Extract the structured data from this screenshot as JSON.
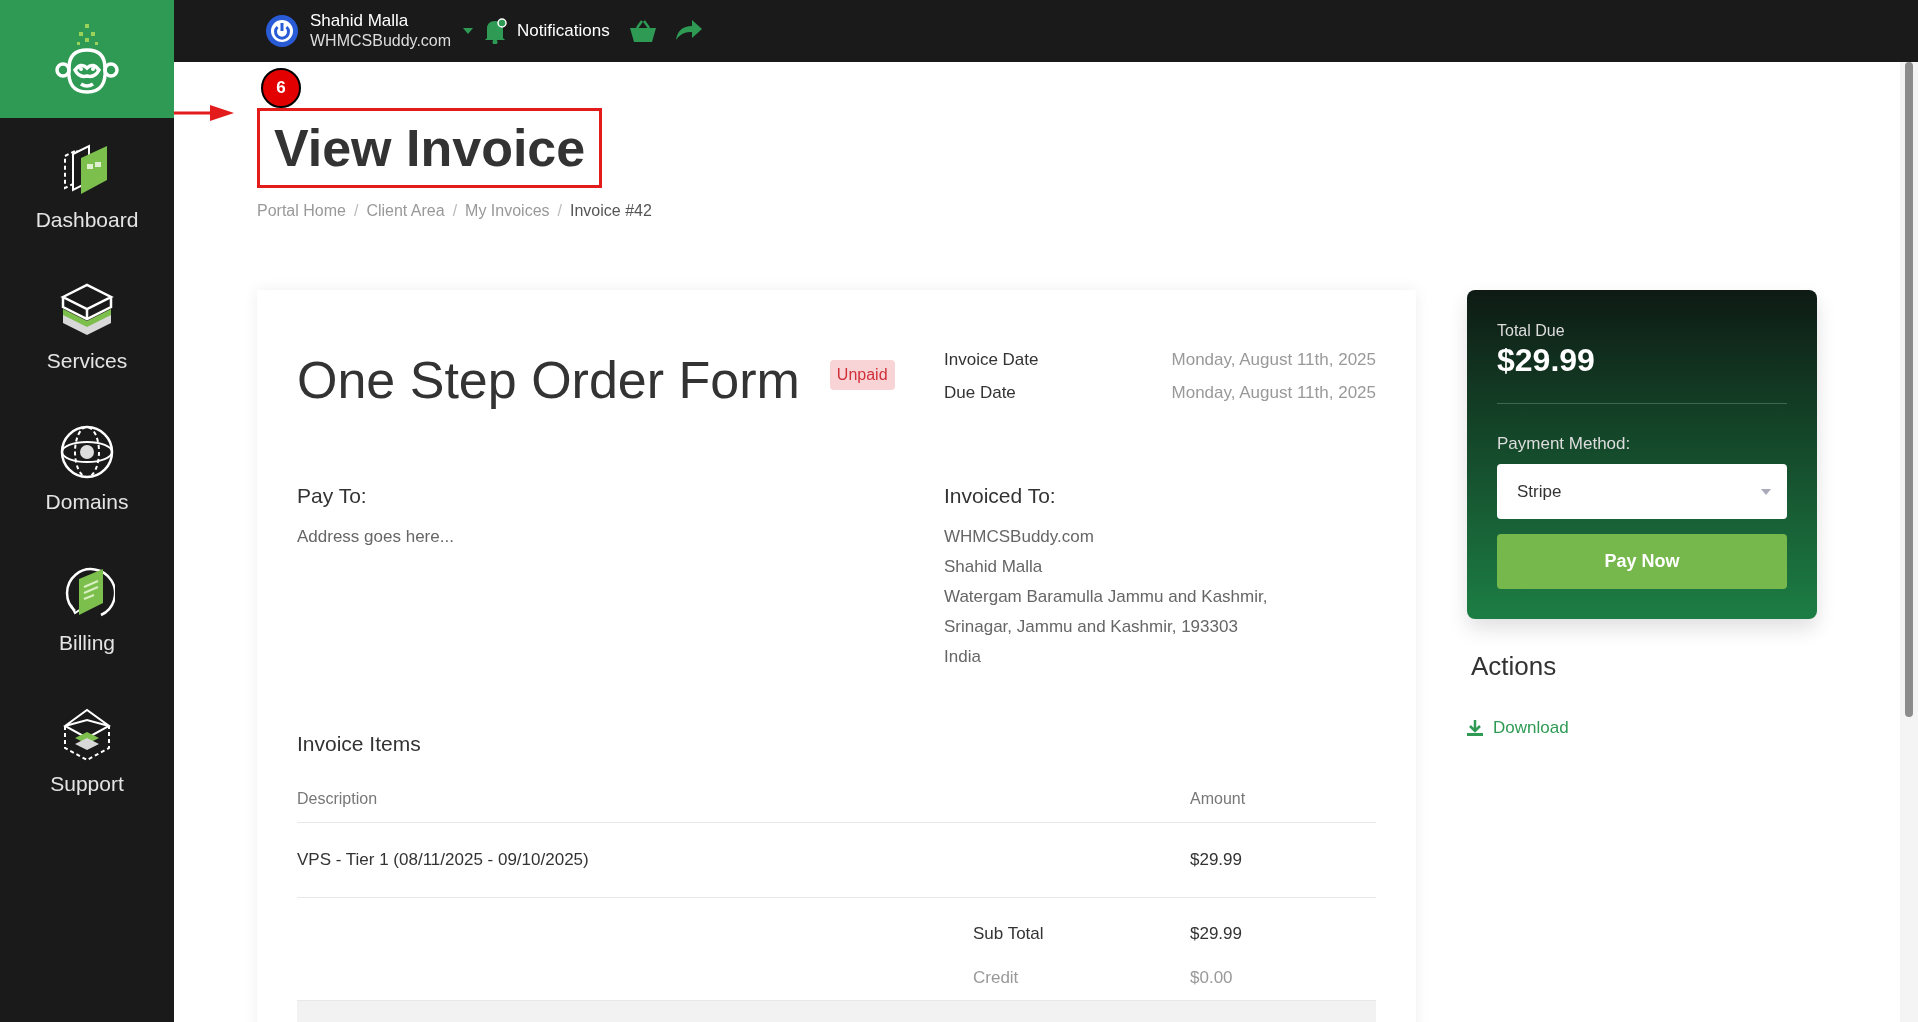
{
  "sidebar": {
    "items": [
      {
        "label": "Dashboard",
        "kind": "dashboard"
      },
      {
        "label": "Services",
        "kind": "services"
      },
      {
        "label": "Domains",
        "kind": "domains"
      },
      {
        "label": "Billing",
        "kind": "billing"
      },
      {
        "label": "Support",
        "kind": "support"
      }
    ]
  },
  "topbar": {
    "user": {
      "name": "Shahid Malla",
      "company": "WHMCSBuddy.com"
    },
    "notifications": "Notifications"
  },
  "annotation": {
    "step": "6"
  },
  "page": {
    "title": "View Invoice",
    "breadcrumb": [
      {
        "label": "Portal Home",
        "current": false
      },
      {
        "label": "Client Area",
        "current": false
      },
      {
        "label": "My Invoices",
        "current": false
      },
      {
        "label": "Invoice #42",
        "current": true
      }
    ],
    "separator": "/"
  },
  "invoice": {
    "title": "One Step Order Form",
    "status": "Unpaid",
    "dates": [
      {
        "label": "Invoice Date",
        "value": "Monday, August 11th, 2025"
      },
      {
        "label": "Due Date",
        "value": "Monday, August 11th, 2025"
      }
    ],
    "pay_to": {
      "heading": "Pay To:",
      "lines": [
        "Address goes here..."
      ]
    },
    "invoiced_to": {
      "heading": "Invoiced To:",
      "lines": [
        "WHMCSBuddy.com",
        "Shahid Malla",
        "Watergam Baramulla Jammu and Kashmir,",
        "Srinagar, Jammu and Kashmir, 193303",
        "India"
      ]
    },
    "items_heading": "Invoice Items",
    "columns": [
      "Description",
      "Amount"
    ],
    "rows": [
      {
        "description": "VPS - Tier 1 (08/11/2025 - 09/10/2025)",
        "amount": "$29.99"
      }
    ],
    "totals": [
      {
        "label": "Sub Total",
        "value": "$29.99",
        "muted": false
      },
      {
        "label": "Credit",
        "value": "$0.00",
        "muted": true
      }
    ]
  },
  "summary": {
    "total_label": "Total Due",
    "total": "$29.99",
    "payment_label": "Payment Method:",
    "payment_method": "Stripe",
    "pay_button": "Pay Now"
  },
  "actions": {
    "heading": "Actions",
    "links": [
      "Download"
    ]
  }
}
